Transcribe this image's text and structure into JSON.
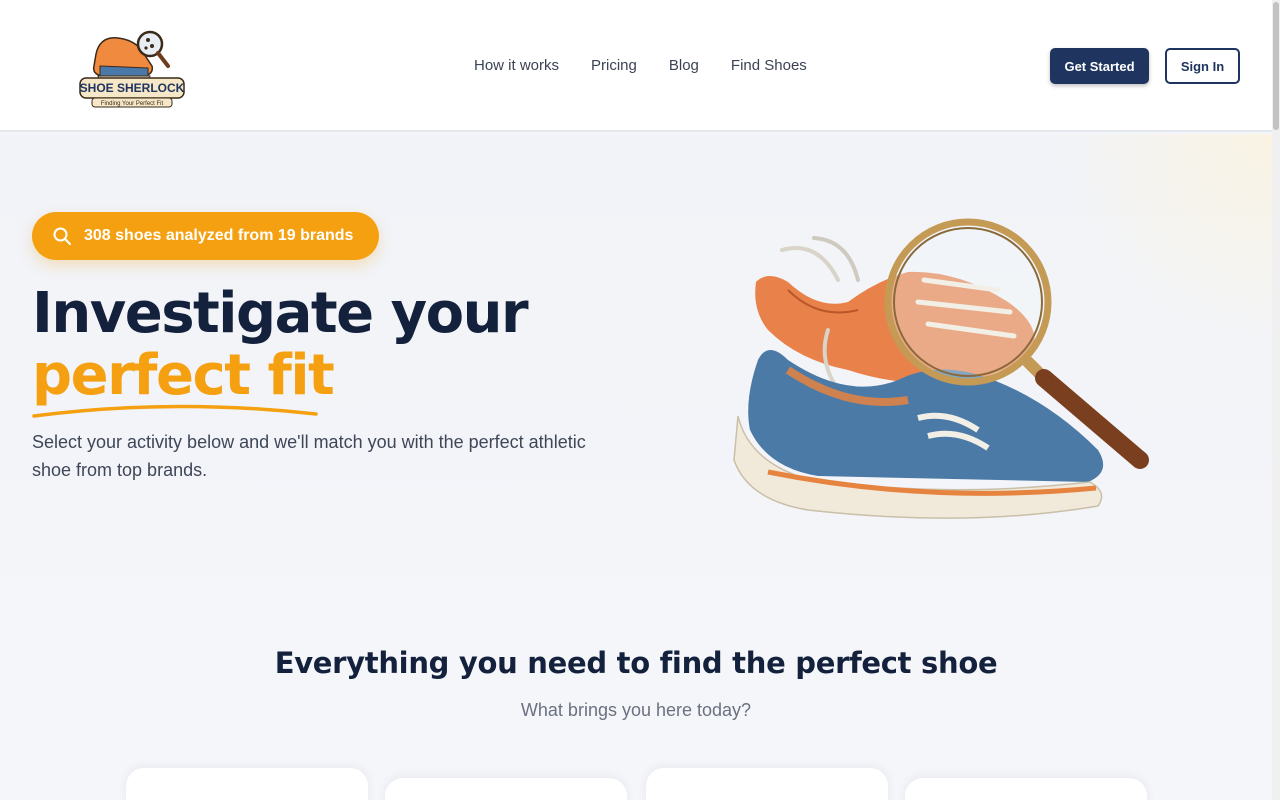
{
  "logo": {
    "line1": "SHOE SHERLOCK",
    "line2": "Finding Your Perfect Fit"
  },
  "nav": {
    "items": [
      {
        "label": "How it works"
      },
      {
        "label": "Pricing"
      },
      {
        "label": "Blog"
      },
      {
        "label": "Find Shoes"
      }
    ]
  },
  "header": {
    "get_started": "Get Started",
    "sign_in": "Sign In"
  },
  "hero": {
    "badge": "308 shoes analyzed from 19 brands",
    "title_line1": "Investigate your",
    "title_line2": "perfect fit",
    "subtitle": "Select your activity below and we'll match you with the perfect athletic shoe from top brands."
  },
  "section": {
    "title": "Everything you need to find the perfect shoe",
    "subtitle": "What brings you here today?"
  },
  "colors": {
    "primary": "#1f3560",
    "accent": "#f5a011",
    "text": "#14213d"
  },
  "icons": {
    "badge": "search-icon"
  }
}
